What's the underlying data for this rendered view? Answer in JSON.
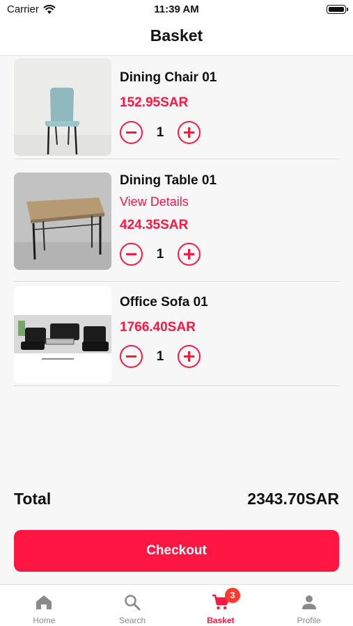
{
  "status_bar": {
    "carrier": "Carrier",
    "time": "11:39 AM"
  },
  "header": {
    "title": "Basket"
  },
  "items": [
    {
      "name": "Dining Chair 01",
      "details": "",
      "price": "152.95SAR",
      "quantity": "1"
    },
    {
      "name": "Dining Table 01",
      "details": "View Details",
      "price": "424.35SAR",
      "quantity": "1"
    },
    {
      "name": "Office Sofa 01",
      "details": "",
      "price": "1766.40SAR",
      "quantity": "1"
    }
  ],
  "summary": {
    "total_label": "Total",
    "total_value": "2343.70SAR"
  },
  "checkout_label": "Checkout",
  "tabs": [
    {
      "label": "Home",
      "icon": "home-icon"
    },
    {
      "label": "Search",
      "icon": "search-icon"
    },
    {
      "label": "Basket",
      "icon": "cart-icon",
      "badge": "3",
      "active": true
    },
    {
      "label": "Profile",
      "icon": "person-icon"
    }
  ],
  "colors": {
    "accent": "#ff1744",
    "badge": "#ff3b30",
    "inactive_tab": "#8a8a8a"
  }
}
